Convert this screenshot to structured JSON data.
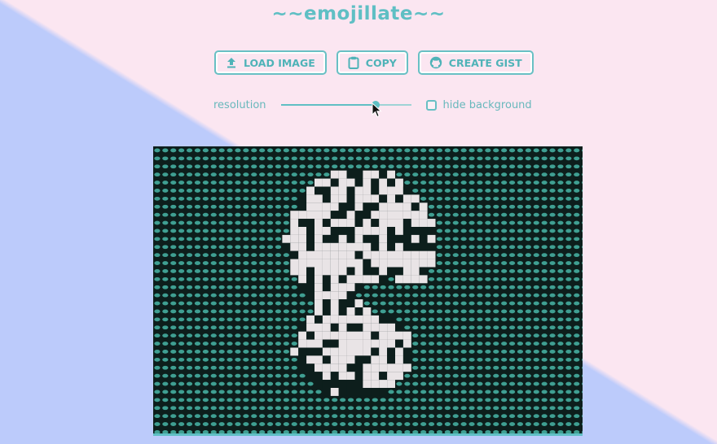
{
  "app": {
    "title": "~~emojillate~~"
  },
  "toolbar": {
    "load_label": "LOAD IMAGE",
    "copy_label": "COPY",
    "gist_label": "CREATE GIST"
  },
  "controls": {
    "resolution_label": "resolution",
    "resolution_value": 0.73,
    "hide_background_label": "hide background",
    "hide_background_checked": false
  },
  "preview": {
    "background_emoji_color": "#3f9f92",
    "figure_color": "#e9e4e6",
    "dark_color": "#0d1e1c"
  },
  "colors": {
    "accent": "#5fbfc4",
    "pink_bg": "#fbe6f1",
    "blue_bg": "#bccbfb"
  },
  "icons": [
    "upload-icon",
    "clipboard-icon",
    "github-icon",
    "cursor-icon"
  ]
}
